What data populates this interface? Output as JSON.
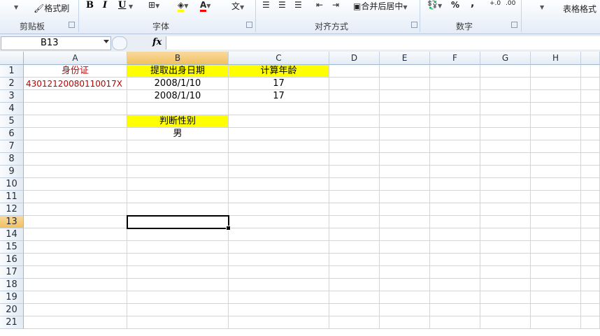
{
  "ribbon": {
    "groups": [
      "剪贴板",
      "字体",
      "对齐方式",
      "数字"
    ],
    "format_painter": "格式刷",
    "merge_center": "合并后居中",
    "percent": "%",
    "comma": ",",
    "table_format": "表格格式",
    "bold": "B",
    "italic": "I",
    "underline": "U",
    "phonetic": "文"
  },
  "formula_bar": {
    "name_box": "B13",
    "fx": "fx",
    "formula": ""
  },
  "columns": [
    "A",
    "B",
    "C",
    "D",
    "E",
    "F",
    "G",
    "H"
  ],
  "rows": [
    "1",
    "2",
    "3",
    "4",
    "5",
    "6",
    "7",
    "8",
    "9",
    "10",
    "11",
    "12",
    "13",
    "14",
    "15",
    "16",
    "17",
    "18",
    "19",
    "20",
    "21"
  ],
  "selected": {
    "column": "B",
    "row": "13"
  },
  "cells": {
    "A1": "身份证",
    "B1": "提取出身日期",
    "C1": "计算年龄",
    "A2": "43012120080110017X",
    "B2": "2008/1/10",
    "C2": "17",
    "B3": "2008/1/10",
    "C3": "17",
    "B5": "判断性别",
    "B6": "男"
  },
  "colors": {
    "highlight": "#ffff00",
    "id_text": "#c00000",
    "selection_header": "#f6c96a"
  }
}
